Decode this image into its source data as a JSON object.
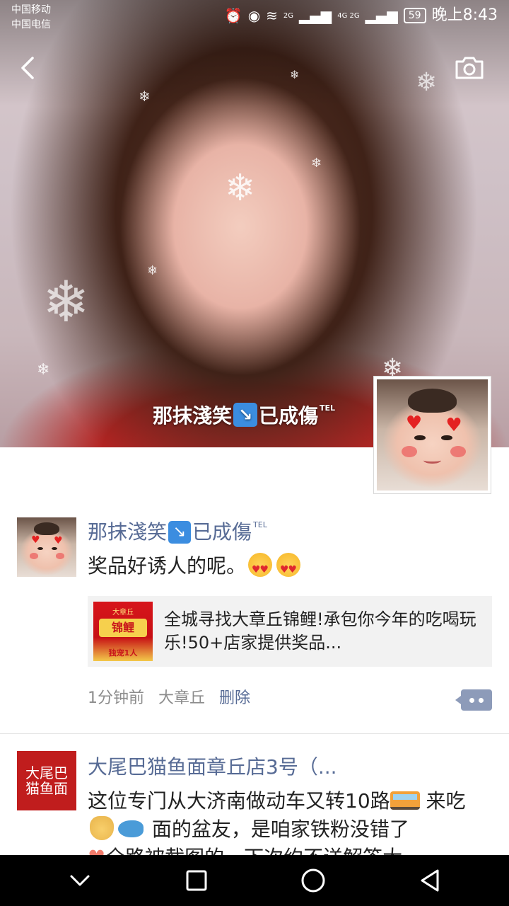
{
  "status_bar": {
    "carrier_1": "中国移动",
    "carrier_2": "中国电信",
    "signal_1": "2G",
    "signal_2": "4G 2G",
    "battery": "59",
    "time": "晚上8:43"
  },
  "cover": {
    "username_part1": "那抹淺笑",
    "username_part2": "已成傷",
    "username_sup": "TEL"
  },
  "posts": [
    {
      "author_part1": "那抹淺笑",
      "author_part2": "已成傷",
      "author_sup": "TEL",
      "text": "奖品好诱人的呢。",
      "link": {
        "thumb_top": "大章丘",
        "thumb_title": "锦鲤",
        "thumb_bottom": "独宠1人",
        "title": "全城寻找大章丘锦鲤!承包你今年的吃喝玩乐!50+店家提供奖品..."
      },
      "time": "1分钟前",
      "location": "大章丘",
      "delete_label": "删除"
    },
    {
      "author": "大尾巴猫鱼面章丘店3号（...",
      "avatar_text": "大尾巴猫鱼面",
      "text_part1": "这位专门从大济南做动车又转10路",
      "text_part2": " 来吃",
      "text_part3": " 面的盆友，是咱家铁粉没错了",
      "text_part4": "全路被截图的，下次约不送解答大"
    }
  ],
  "icons": {
    "back": "chevron-left-icon",
    "camera": "camera-icon",
    "comment": "comment-icon",
    "nav_back": "triangle-back-icon",
    "nav_home": "circle-home-icon",
    "nav_recent": "square-recent-icon",
    "nav_hide": "chevron-down-icon"
  }
}
